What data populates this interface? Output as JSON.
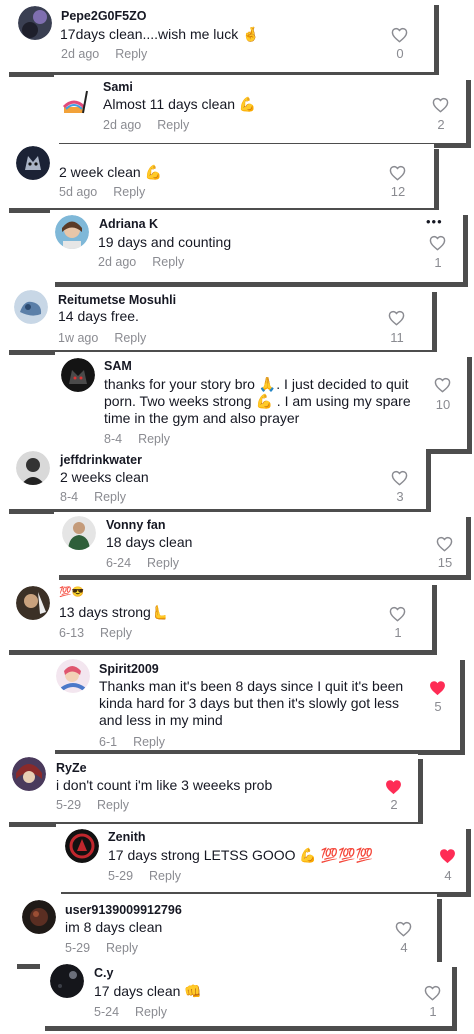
{
  "comments": [
    {
      "user": "Pepe2G0F5ZO",
      "text": "17days clean....wish me luck 🤞",
      "date": "2d ago",
      "reply": "Reply",
      "likes": "0",
      "liked": false
    },
    {
      "user": "Sami",
      "text": "Almost 11 days clean 💪",
      "date": "2d ago",
      "reply": "Reply",
      "likes": "2",
      "liked": false
    },
    {
      "user": "⠀⠀⠀⠀⠀⠀⠀",
      "text": "2 week clean 💪",
      "date": "5d ago",
      "reply": "Reply",
      "likes": "12",
      "liked": false
    },
    {
      "user": "Adriana K",
      "text": "19 days and counting",
      "date": "2d ago",
      "reply": "Reply",
      "likes": "1",
      "liked": false
    },
    {
      "user": "Reitumetse Mosuhli",
      "text": "14 days free.",
      "date": "1w ago",
      "reply": "Reply",
      "likes": "11",
      "liked": false
    },
    {
      "user": "SAM",
      "text": "thanks for your story bro 🙏. I just decided to quit porn. Two weeks strong 💪 . I am using my spare time in the gym and also prayer",
      "date": "8-4",
      "reply": "Reply",
      "likes": "10",
      "liked": false
    },
    {
      "user": "jeffdrinkwater",
      "text": "2 weeks clean",
      "date": "8-4",
      "reply": "Reply",
      "likes": "3",
      "liked": false
    },
    {
      "user": "Vonny fan",
      "text": "18 days clean",
      "date": "6-24",
      "reply": "Reply",
      "likes": "15",
      "liked": false
    },
    {
      "user": "💯😎",
      "text": "13 days strong🫷",
      "date": "6-13",
      "reply": "Reply",
      "likes": "1",
      "liked": false
    },
    {
      "user": "Spirit2009",
      "text": "Thanks man it's been 8 days since I quit it's been kinda hard for 3 days but then it's slowly got less and less in my mind",
      "date": "6-1",
      "reply": "Reply",
      "likes": "5",
      "liked": true
    },
    {
      "user": "RyZe",
      "text": "i don't count i'm like 3 weeeks prob",
      "date": "5-29",
      "reply": "Reply",
      "likes": "2",
      "liked": true
    },
    {
      "user": "Zenith",
      "text": "17 days strong LETSS GOOO 💪 💯💯💯",
      "date": "5-29",
      "reply": "Reply",
      "likes": "4",
      "liked": true
    },
    {
      "user": "user9139009912796",
      "text": "im 8 days clean",
      "date": "5-29",
      "reply": "Reply",
      "likes": "4",
      "liked": false
    },
    {
      "user": "C.y",
      "text": "17 days clean 👊",
      "date": "5-24",
      "reply": "Reply",
      "likes": "1",
      "liked": false
    }
  ],
  "more_options": "•••",
  "colors": {
    "liked": "#fe2c55",
    "text": "#161823",
    "muted": "#8a8b91",
    "shadow": "#4d4d4d"
  },
  "icons": {
    "like": "heart-outline-icon",
    "liked": "heart-filled-icon"
  }
}
